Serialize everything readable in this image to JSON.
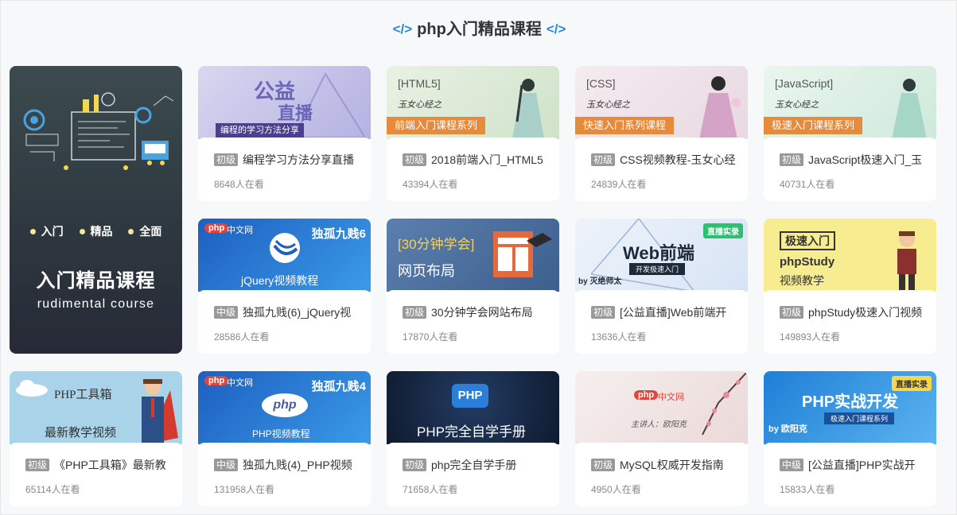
{
  "section": {
    "title": "php入门精品课程",
    "code_icon": "</>"
  },
  "featured": {
    "tags": [
      "入门",
      "精品",
      "全面"
    ],
    "title_cn": "入门精品课程",
    "title_en": "rudimental course"
  },
  "courses": [
    {
      "level": "初级",
      "name": "编程学习方法分享直播",
      "viewers": "8648人在看",
      "thumb": {
        "line1": "公益",
        "line2": "直播",
        "caption": "编程的学习方法分享"
      }
    },
    {
      "level": "初级",
      "name": "2018前端入门_HTML5",
      "viewers": "43394人在看",
      "thumb": {
        "bracket": "[HTML5]",
        "script": "玉女心经之",
        "tag": "前端入门课程系列"
      }
    },
    {
      "level": "初级",
      "name": "CSS视频教程-玉女心经",
      "viewers": "24839人在看",
      "thumb": {
        "bracket": "[CSS]",
        "script": "玉女心经之",
        "tag": "快速入门系列课程"
      }
    },
    {
      "level": "初级",
      "name": "JavaScript极速入门_玉",
      "viewers": "40731人在看",
      "thumb": {
        "bracket": "[JavaScript]",
        "script": "玉女心经之",
        "tag": "极速入门课程系列"
      }
    },
    {
      "level": "中级",
      "name": "独孤九贱(6)_jQuery视",
      "viewers": "28586人在看",
      "thumb": {
        "brand": "php",
        "brand_cn": "中文网",
        "series": "独孤九贱6",
        "caption": "jQuery视频教程"
      }
    },
    {
      "level": "初级",
      "name": "30分钟学会网站布局",
      "viewers": "17870人在看",
      "thumb": {
        "top": "[30分钟学会]",
        "bottom": "网页布局"
      }
    },
    {
      "level": "初级",
      "name": "[公益直播]Web前端开",
      "viewers": "13636人在看",
      "thumb": {
        "badge": "直播实录",
        "title": "Web前端",
        "sub": "开发极速入门",
        "author": "by 灭绝师太"
      }
    },
    {
      "level": "初级",
      "name": "phpStudy极速入门视频",
      "viewers": "149893人在看",
      "thumb": {
        "tag": "极速入门",
        "title": "phpStudy",
        "sub": "视频教学"
      }
    },
    {
      "level": "初级",
      "name": "《PHP工具箱》最新教",
      "viewers": "65114人在看",
      "thumb": {
        "title": "PHP工具箱",
        "sub": "最新教学视频"
      }
    },
    {
      "level": "中级",
      "name": "独孤九贱(4)_PHP视频",
      "viewers": "131958人在看",
      "thumb": {
        "brand": "php",
        "brand_cn": "中文网",
        "series": "独孤九贱4",
        "logo": "php",
        "caption": "PHP视频教程"
      }
    },
    {
      "level": "初级",
      "name": "php完全自学手册",
      "viewers": "71658人在看",
      "thumb": {
        "logo": "PHP",
        "caption": "PHP完全自学手册"
      }
    },
    {
      "level": "初级",
      "name": "MySQL权威开发指南",
      "viewers": "4950人在看",
      "thumb": {
        "brand": "php",
        "brand_cn": "中文网",
        "speaker": "主讲人：欧阳克"
      }
    },
    {
      "level": "中级",
      "name": "[公益直播]PHP实战开",
      "viewers": "15833人在看",
      "thumb": {
        "badge": "直播实录",
        "title": "PHP实战开发",
        "sub": "极速入门课程系列",
        "author": "by 欧阳克"
      }
    }
  ]
}
